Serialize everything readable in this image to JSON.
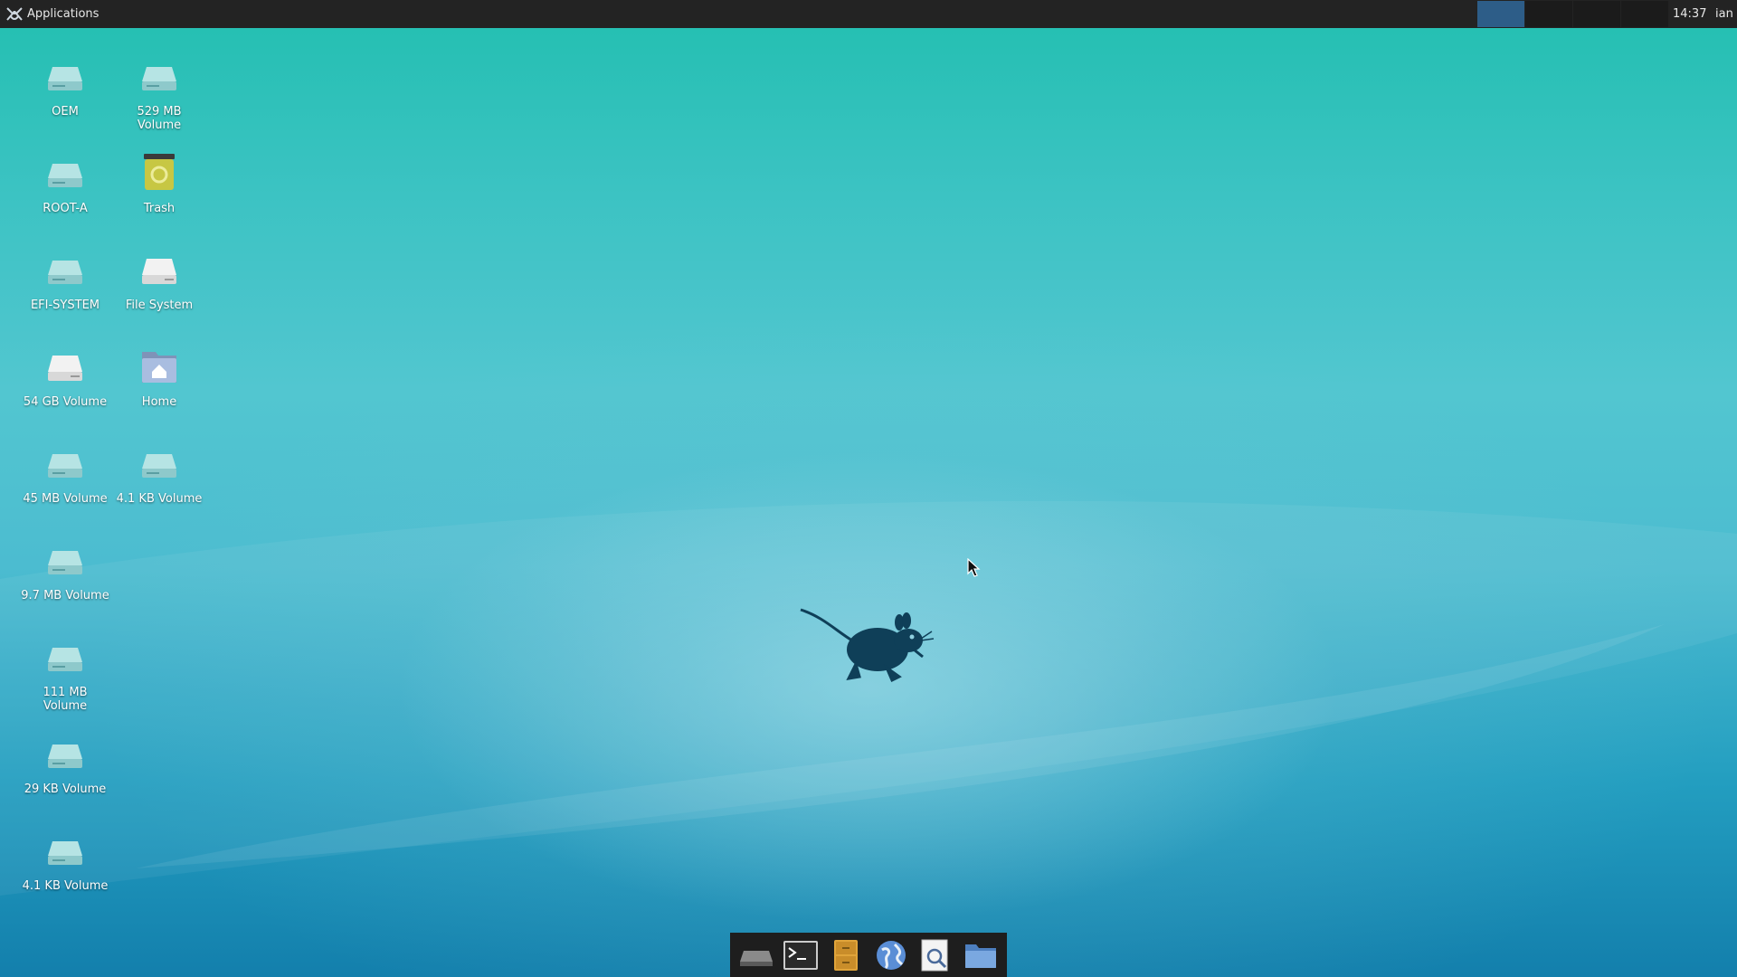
{
  "panel": {
    "applications_label": "Applications",
    "clock": "14:37",
    "user": "ian",
    "workspaces": [
      {
        "active": true
      },
      {
        "active": false
      },
      {
        "active": false
      },
      {
        "active": false
      }
    ]
  },
  "desktop_icons": [
    {
      "label": "OEM",
      "icon": "drive-icon"
    },
    {
      "label": "529 MB Volume",
      "icon": "drive-icon"
    },
    {
      "label": "ROOT-A",
      "icon": "drive-icon"
    },
    {
      "label": "Trash",
      "icon": "trash-icon"
    },
    {
      "label": "EFI-SYSTEM",
      "icon": "drive-icon"
    },
    {
      "label": "File System",
      "icon": "harddisk-icon"
    },
    {
      "label": "54 GB Volume",
      "icon": "harddisk-icon"
    },
    {
      "label": "Home",
      "icon": "home-folder-icon"
    },
    {
      "label": "45 MB Volume",
      "icon": "drive-icon"
    },
    {
      "label": "4.1 KB Volume",
      "icon": "drive-icon"
    },
    {
      "label": "9.7 MB Volume",
      "icon": "drive-icon"
    },
    {
      "label": "111 MB Volume",
      "icon": "drive-icon"
    },
    {
      "label": "29 KB Volume",
      "icon": "drive-icon"
    },
    {
      "label": "4.1 KB Volume",
      "icon": "drive-icon"
    }
  ],
  "dock": [
    {
      "name": "show-desktop",
      "icon": "show-desktop-icon"
    },
    {
      "name": "terminal",
      "icon": "terminal-icon"
    },
    {
      "name": "file-manager",
      "icon": "file-cabinet-icon"
    },
    {
      "name": "web-browser",
      "icon": "globe-icon"
    },
    {
      "name": "app-finder",
      "icon": "magnifier-icon"
    },
    {
      "name": "folder",
      "icon": "folder-icon"
    }
  ],
  "colors": {
    "panel_bg": "#232323",
    "workspace_active": "#2d5d88",
    "dock_bg": "#1e1e1e",
    "mascot": "#0f3f58"
  }
}
